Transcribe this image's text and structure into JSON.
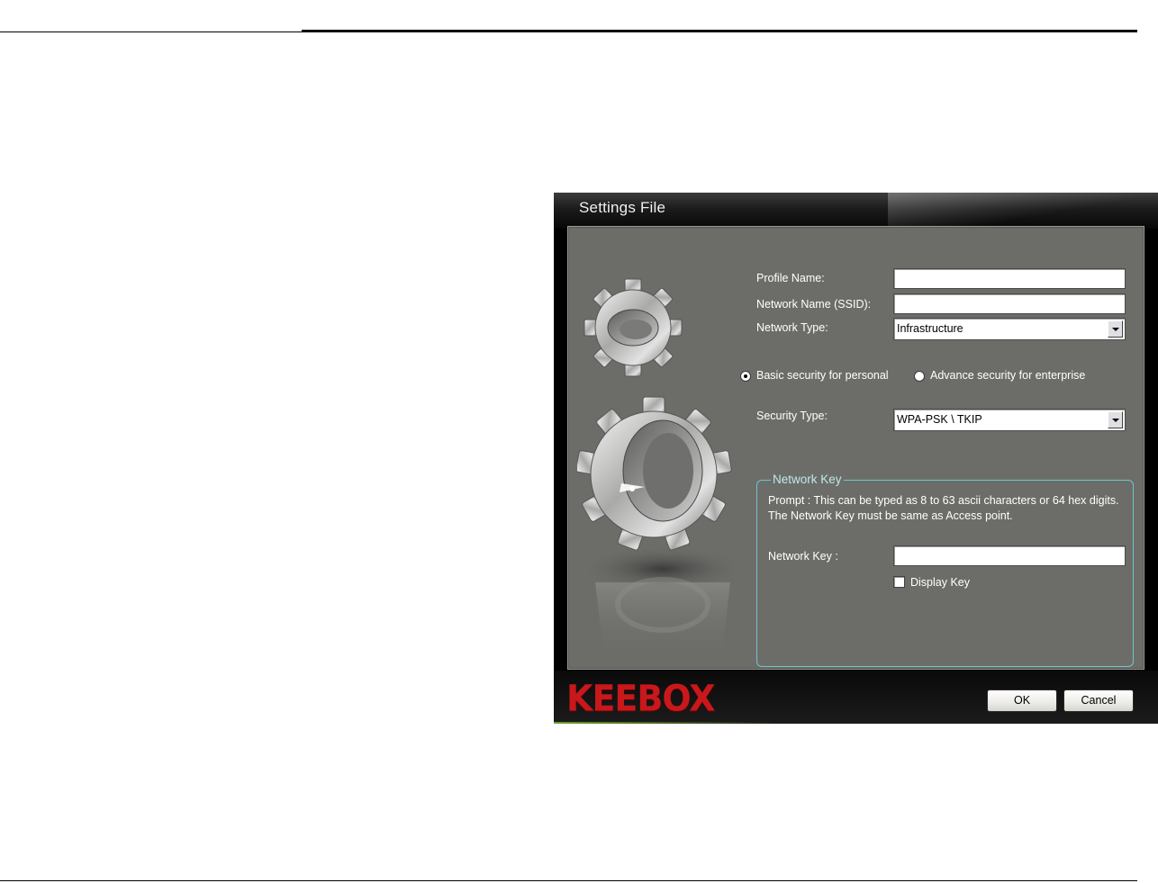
{
  "dialog": {
    "title": "Settings File",
    "fields": {
      "profile_name": {
        "label": "Profile Name:",
        "value": ""
      },
      "ssid": {
        "label": "Network Name (SSID):",
        "value": ""
      },
      "network_type": {
        "label": "Network Type:",
        "value": "Infrastructure"
      },
      "security_type": {
        "label": "Security Type:",
        "value": "WPA-PSK \\ TKIP"
      }
    },
    "security_mode": {
      "basic_label": "Basic security for personal",
      "advanced_label": "Advance security for enterprise",
      "selected": "basic"
    },
    "network_key": {
      "legend": "Network Key",
      "prompt": "Prompt : This can be typed as 8 to 63 ascii characters or  64 hex digits. The Network Key must be same as Access point.",
      "label": "Network Key :",
      "value": "",
      "display_key_label": "Display Key",
      "display_key_checked": false
    },
    "logo_text": "KEEBOX",
    "buttons": {
      "ok": "OK",
      "cancel": "Cancel"
    },
    "colors": {
      "panel": "#6c6d69",
      "accent_border": "#6fc6c8",
      "logo": "#c8181c"
    },
    "icons": [
      "gears-illustration-icon",
      "dropdown-arrow-icon"
    ]
  }
}
